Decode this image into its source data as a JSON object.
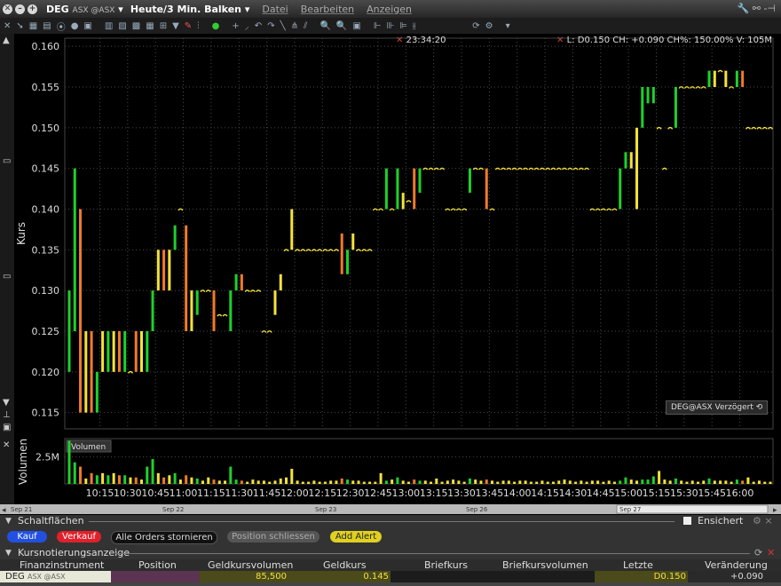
{
  "title": {
    "symbol": "DEG",
    "exchange": "ASX @ASX",
    "period": "Heute/3 Min. Balken"
  },
  "menu": [
    "Datei",
    "Bearbeiten",
    "Anzeigen"
  ],
  "info": {
    "time": "23:34:20",
    "quote_line": "L: D0.150 CH: +0.090 CH%: 150.00% V: 105M"
  },
  "delayed_badge": "DEG@ASX Verzögert",
  "colors": {
    "up": "#1ed12a",
    "down": "#f07a2a",
    "neutral": "#f5e23a",
    "grid": "#4a4a4a",
    "bg": "#000000",
    "tick_text": "#dddddd"
  },
  "chart_data": {
    "type": "ohlc-bar",
    "ylabel": "Kurs",
    "ylim": [
      0.113,
      0.161
    ],
    "yticks": [
      "0.115",
      "0.120",
      "0.125",
      "0.130",
      "0.135",
      "0.140",
      "0.145",
      "0.150",
      "0.155",
      "0.160"
    ],
    "xticks": [
      "10:15",
      "10:30",
      "10:45",
      "11:00",
      "11:15",
      "11:30",
      "11:45",
      "12:00",
      "12:15",
      "12:30",
      "12:45",
      "13:00",
      "13:15",
      "13:30",
      "13:45",
      "14:00",
      "14:15",
      "14:30",
      "14:45",
      "15:00",
      "15:15",
      "15:30",
      "15:45",
      "16:00"
    ],
    "bars": [
      {
        "low": 0.12,
        "high": 0.13,
        "c": "up"
      },
      {
        "low": 0.125,
        "high": 0.145,
        "c": "up"
      },
      {
        "low": 0.115,
        "high": 0.14,
        "c": "down"
      },
      {
        "low": 0.115,
        "high": 0.125,
        "c": "neutral"
      },
      {
        "low": 0.115,
        "high": 0.125,
        "c": "down"
      },
      {
        "low": 0.115,
        "high": 0.12,
        "c": "up"
      },
      {
        "low": 0.12,
        "high": 0.125,
        "c": "neutral"
      },
      {
        "low": 0.12,
        "high": 0.125,
        "c": "up"
      },
      {
        "low": 0.12,
        "high": 0.125,
        "c": "neutral"
      },
      {
        "low": 0.12,
        "high": 0.125,
        "c": "down"
      },
      {
        "low": 0.12,
        "high": 0.125,
        "c": "up"
      },
      {
        "low": 0.12,
        "high": 0.12,
        "c": "neutral"
      },
      {
        "low": 0.12,
        "high": 0.125,
        "c": "down"
      },
      {
        "low": 0.12,
        "high": 0.125,
        "c": "neutral"
      },
      {
        "low": 0.12,
        "high": 0.125,
        "c": "up"
      },
      {
        "low": 0.125,
        "high": 0.13,
        "c": "up"
      },
      {
        "low": 0.13,
        "high": 0.135,
        "c": "neutral"
      },
      {
        "low": 0.13,
        "high": 0.135,
        "c": "down"
      },
      {
        "low": 0.13,
        "high": 0.135,
        "c": "neutral"
      },
      {
        "low": 0.135,
        "high": 0.138,
        "c": "up"
      },
      {
        "low": 0.14,
        "high": 0.14,
        "c": "neutral"
      },
      {
        "low": 0.125,
        "high": 0.138,
        "c": "down"
      },
      {
        "low": 0.125,
        "high": 0.13,
        "c": "neutral"
      },
      {
        "low": 0.127,
        "high": 0.13,
        "c": "up"
      },
      {
        "low": 0.13,
        "high": 0.13,
        "c": "neutral"
      },
      {
        "low": 0.13,
        "high": 0.13,
        "c": "neutral"
      },
      {
        "low": 0.125,
        "high": 0.13,
        "c": "down"
      },
      {
        "low": 0.127,
        "high": 0.127,
        "c": "neutral"
      },
      {
        "low": 0.127,
        "high": 0.127,
        "c": "neutral"
      },
      {
        "low": 0.125,
        "high": 0.13,
        "c": "up"
      },
      {
        "low": 0.13,
        "high": 0.132,
        "c": "up"
      },
      {
        "low": 0.13,
        "high": 0.132,
        "c": "down"
      },
      {
        "low": 0.13,
        "high": 0.13,
        "c": "neutral"
      },
      {
        "low": 0.13,
        "high": 0.13,
        "c": "neutral"
      },
      {
        "low": 0.13,
        "high": 0.13,
        "c": "neutral"
      },
      {
        "low": 0.125,
        "high": 0.125,
        "c": "neutral"
      },
      {
        "low": 0.125,
        "high": 0.125,
        "c": "neutral"
      },
      {
        "low": 0.127,
        "high": 0.13,
        "c": "neutral"
      },
      {
        "low": 0.13,
        "high": 0.132,
        "c": "neutral"
      },
      {
        "low": 0.135,
        "high": 0.135,
        "c": "neutral"
      },
      {
        "low": 0.135,
        "high": 0.14,
        "c": "neutral"
      },
      {
        "low": 0.135,
        "high": 0.135,
        "c": "neutral"
      },
      {
        "low": 0.135,
        "high": 0.135,
        "c": "neutral"
      },
      {
        "low": 0.135,
        "high": 0.135,
        "c": "neutral"
      },
      {
        "low": 0.135,
        "high": 0.135,
        "c": "neutral"
      },
      {
        "low": 0.135,
        "high": 0.135,
        "c": "neutral"
      },
      {
        "low": 0.135,
        "high": 0.135,
        "c": "neutral"
      },
      {
        "low": 0.135,
        "high": 0.135,
        "c": "neutral"
      },
      {
        "low": 0.135,
        "high": 0.135,
        "c": "neutral"
      },
      {
        "low": 0.132,
        "high": 0.137,
        "c": "down"
      },
      {
        "low": 0.132,
        "high": 0.135,
        "c": "up"
      },
      {
        "low": 0.135,
        "high": 0.137,
        "c": "neutral"
      },
      {
        "low": 0.135,
        "high": 0.135,
        "c": "neutral"
      },
      {
        "low": 0.135,
        "high": 0.135,
        "c": "neutral"
      },
      {
        "low": 0.135,
        "high": 0.135,
        "c": "neutral"
      },
      {
        "low": 0.14,
        "high": 0.14,
        "c": "neutral"
      },
      {
        "low": 0.14,
        "high": 0.14,
        "c": "neutral"
      },
      {
        "low": 0.14,
        "high": 0.145,
        "c": "up"
      },
      {
        "low": 0.14,
        "high": 0.14,
        "c": "neutral"
      },
      {
        "low": 0.14,
        "high": 0.145,
        "c": "up"
      },
      {
        "low": 0.14,
        "high": 0.142,
        "c": "neutral"
      },
      {
        "low": 0.141,
        "high": 0.141,
        "c": "neutral"
      },
      {
        "low": 0.14,
        "high": 0.145,
        "c": "down"
      },
      {
        "low": 0.142,
        "high": 0.145,
        "c": "up"
      },
      {
        "low": 0.145,
        "high": 0.145,
        "c": "neutral"
      },
      {
        "low": 0.145,
        "high": 0.145,
        "c": "neutral"
      },
      {
        "low": 0.145,
        "high": 0.145,
        "c": "neutral"
      },
      {
        "low": 0.145,
        "high": 0.145,
        "c": "neutral"
      },
      {
        "low": 0.14,
        "high": 0.14,
        "c": "neutral"
      },
      {
        "low": 0.14,
        "high": 0.14,
        "c": "neutral"
      },
      {
        "low": 0.14,
        "high": 0.14,
        "c": "neutral"
      },
      {
        "low": 0.14,
        "high": 0.14,
        "c": "neutral"
      },
      {
        "low": 0.142,
        "high": 0.145,
        "c": "up"
      },
      {
        "low": 0.145,
        "high": 0.145,
        "c": "neutral"
      },
      {
        "low": 0.145,
        "high": 0.145,
        "c": "neutral"
      },
      {
        "low": 0.14,
        "high": 0.145,
        "c": "down"
      },
      {
        "low": 0.14,
        "high": 0.14,
        "c": "neutral"
      },
      {
        "low": 0.145,
        "high": 0.145,
        "c": "neutral"
      },
      {
        "low": 0.145,
        "high": 0.145,
        "c": "neutral"
      },
      {
        "low": 0.145,
        "high": 0.145,
        "c": "neutral"
      },
      {
        "low": 0.145,
        "high": 0.145,
        "c": "neutral"
      },
      {
        "low": 0.145,
        "high": 0.145,
        "c": "neutral"
      },
      {
        "low": 0.145,
        "high": 0.145,
        "c": "neutral"
      },
      {
        "low": 0.145,
        "high": 0.145,
        "c": "neutral"
      },
      {
        "low": 0.145,
        "high": 0.145,
        "c": "neutral"
      },
      {
        "low": 0.145,
        "high": 0.145,
        "c": "neutral"
      },
      {
        "low": 0.145,
        "high": 0.145,
        "c": "neutral"
      },
      {
        "low": 0.145,
        "high": 0.145,
        "c": "neutral"
      },
      {
        "low": 0.145,
        "high": 0.145,
        "c": "neutral"
      },
      {
        "low": 0.145,
        "high": 0.145,
        "c": "neutral"
      },
      {
        "low": 0.145,
        "high": 0.145,
        "c": "neutral"
      },
      {
        "low": 0.145,
        "high": 0.145,
        "c": "neutral"
      },
      {
        "low": 0.145,
        "high": 0.145,
        "c": "neutral"
      },
      {
        "low": 0.145,
        "high": 0.145,
        "c": "neutral"
      },
      {
        "low": 0.14,
        "high": 0.14,
        "c": "neutral"
      },
      {
        "low": 0.14,
        "high": 0.14,
        "c": "neutral"
      },
      {
        "low": 0.14,
        "high": 0.14,
        "c": "neutral"
      },
      {
        "low": 0.14,
        "high": 0.14,
        "c": "neutral"
      },
      {
        "low": 0.14,
        "high": 0.14,
        "c": "neutral"
      },
      {
        "low": 0.14,
        "high": 0.145,
        "c": "up"
      },
      {
        "low": 0.145,
        "high": 0.147,
        "c": "up"
      },
      {
        "low": 0.145,
        "high": 0.147,
        "c": "neutral"
      },
      {
        "low": 0.14,
        "high": 0.15,
        "c": "neutral"
      },
      {
        "low": 0.15,
        "high": 0.155,
        "c": "up"
      },
      {
        "low": 0.153,
        "high": 0.155,
        "c": "up"
      },
      {
        "low": 0.153,
        "high": 0.155,
        "c": "up"
      },
      {
        "low": 0.15,
        "high": 0.15,
        "c": "neutral"
      },
      {
        "low": 0.145,
        "high": 0.145,
        "c": "neutral"
      },
      {
        "low": 0.15,
        "high": 0.15,
        "c": "neutral"
      },
      {
        "low": 0.15,
        "high": 0.155,
        "c": "up"
      },
      {
        "low": 0.155,
        "high": 0.155,
        "c": "neutral"
      },
      {
        "low": 0.155,
        "high": 0.155,
        "c": "neutral"
      },
      {
        "low": 0.155,
        "high": 0.155,
        "c": "neutral"
      },
      {
        "low": 0.155,
        "high": 0.155,
        "c": "neutral"
      },
      {
        "low": 0.155,
        "high": 0.155,
        "c": "neutral"
      },
      {
        "low": 0.155,
        "high": 0.157,
        "c": "up"
      },
      {
        "low": 0.155,
        "high": 0.157,
        "c": "neutral"
      },
      {
        "low": 0.157,
        "high": 0.157,
        "c": "neutral"
      },
      {
        "low": 0.155,
        "high": 0.157,
        "c": "neutral"
      },
      {
        "low": 0.155,
        "high": 0.155,
        "c": "neutral"
      },
      {
        "low": 0.155,
        "high": 0.157,
        "c": "up"
      },
      {
        "low": 0.155,
        "high": 0.157,
        "c": "down"
      },
      {
        "low": 0.15,
        "high": 0.15,
        "c": "neutral"
      },
      {
        "low": 0.15,
        "high": 0.15,
        "c": "neutral"
      },
      {
        "low": 0.15,
        "high": 0.15,
        "c": "neutral"
      },
      {
        "low": 0.15,
        "high": 0.15,
        "c": "neutral"
      },
      {
        "low": 0.15,
        "high": 0.15,
        "c": "neutral"
      }
    ],
    "volume": {
      "label": "Volumen",
      "legend": "Volumen",
      "ytick": "2.5M",
      "ymax": 4.2,
      "values_m": [
        4.0,
        2.0,
        1.6,
        0.5,
        1.0,
        0.8,
        1.0,
        0.8,
        1.0,
        0.8,
        0.8,
        0.6,
        0.6,
        0.4,
        1.6,
        2.3,
        1.0,
        0.6,
        0.8,
        1.0,
        0.4,
        0.8,
        0.6,
        0.5,
        0.3,
        0.6,
        0.4,
        0.3,
        0.3,
        1.6,
        0.4,
        0.3,
        0.2,
        0.4,
        0.3,
        0.3,
        0.2,
        0.3,
        0.5,
        0.6,
        1.4,
        0.3,
        0.2,
        0.2,
        0.3,
        0.2,
        0.2,
        0.3,
        0.3,
        0.5,
        0.4,
        0.3,
        0.3,
        0.2,
        0.2,
        0.2,
        1.0,
        0.3,
        0.4,
        0.6,
        0.3,
        0.2,
        0.4,
        0.3,
        0.3,
        0.2,
        0.5,
        0.2,
        0.3,
        0.4,
        0.3,
        0.2,
        0.5,
        0.4,
        0.3,
        0.4,
        0.3,
        0.2,
        0.3,
        0.3,
        0.2,
        0.3,
        0.3,
        0.2,
        0.2,
        0.3,
        0.2,
        0.2,
        0.3,
        0.4,
        0.3,
        0.2,
        0.3,
        0.2,
        0.3,
        0.3,
        0.2,
        0.3,
        0.2,
        0.3,
        0.6,
        0.4,
        0.3,
        0.4,
        0.4,
        0.7,
        1.2,
        0.4,
        0.3,
        0.5,
        0.3,
        0.2,
        0.3,
        0.2,
        0.3,
        0.5,
        0.3,
        0.3,
        0.3,
        0.2,
        0.4,
        0.3,
        0.6,
        0.2,
        0.3,
        0.2,
        0.2,
        0.3,
        1.0,
        0.3
      ]
    },
    "date_ticks": [
      "Sep 21",
      "Sep 22",
      "Sep 23",
      "Sep 26",
      "Sep 27"
    ]
  },
  "panels": {
    "buttons_panel": {
      "title": "Schaltflächen",
      "secured_label": "Ensichert",
      "buttons": [
        "Kauf",
        "Verkauf",
        "Alle Orders stornieren",
        "Position schliessen",
        "Add Alert"
      ]
    },
    "quote_panel": {
      "title": "Kursnotierungsanzeige",
      "columns": [
        "Finanzinstrument",
        "Position",
        "Geldkursvolumen",
        "Geldkurs",
        "Briefkurs",
        "Briefkursvolumen",
        "Letzte",
        "Veränderung"
      ],
      "row": {
        "instrument": "DEG",
        "instrument_exchange": "ASX @ASX",
        "position": "",
        "bid_size": "85,500",
        "bid": "0.145",
        "ask": "",
        "ask_size": "",
        "last": "D0.150",
        "change": "+0.090"
      }
    }
  }
}
